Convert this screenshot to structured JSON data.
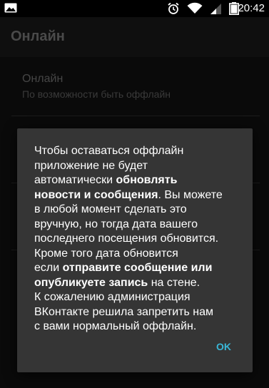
{
  "status_bar": {
    "time": "20:42",
    "icons": [
      "image-icon",
      "alarm-icon",
      "wifi-icon",
      "signal-icon",
      "battery-icon"
    ]
  },
  "app_bar": {
    "title": "Онлайн"
  },
  "preference": {
    "title": "Онлайн",
    "summary": "По возможности быть оффлайн"
  },
  "dialog": {
    "line1": "Чтобы оставаться оффлайн",
    "line2": "приложение не будет",
    "line3a": "автоматически ",
    "line3b": "обновлять",
    "line4a": "новости и сообщения",
    "line4b": ". Вы можете",
    "line5": "в любой момент сделать это",
    "line6": "вручную, но тогда дата вашего",
    "line7": "последнего посещения обновится.",
    "line8": "Кроме того дата обновится",
    "line9a": "если ",
    "line9b": "отправите сообщение или",
    "line10a": "опубликуете запись",
    "line10b": " на стене.",
    "line11": "К сожалению администрация",
    "line12": "ВКонтакте решила запретить нам",
    "line13": "с вами нормальный оффлайн.",
    "ok_label": "OK"
  },
  "colors": {
    "accent": "#39b6d6",
    "dialog_bg": "#353535",
    "background": "#0a0a0a"
  }
}
